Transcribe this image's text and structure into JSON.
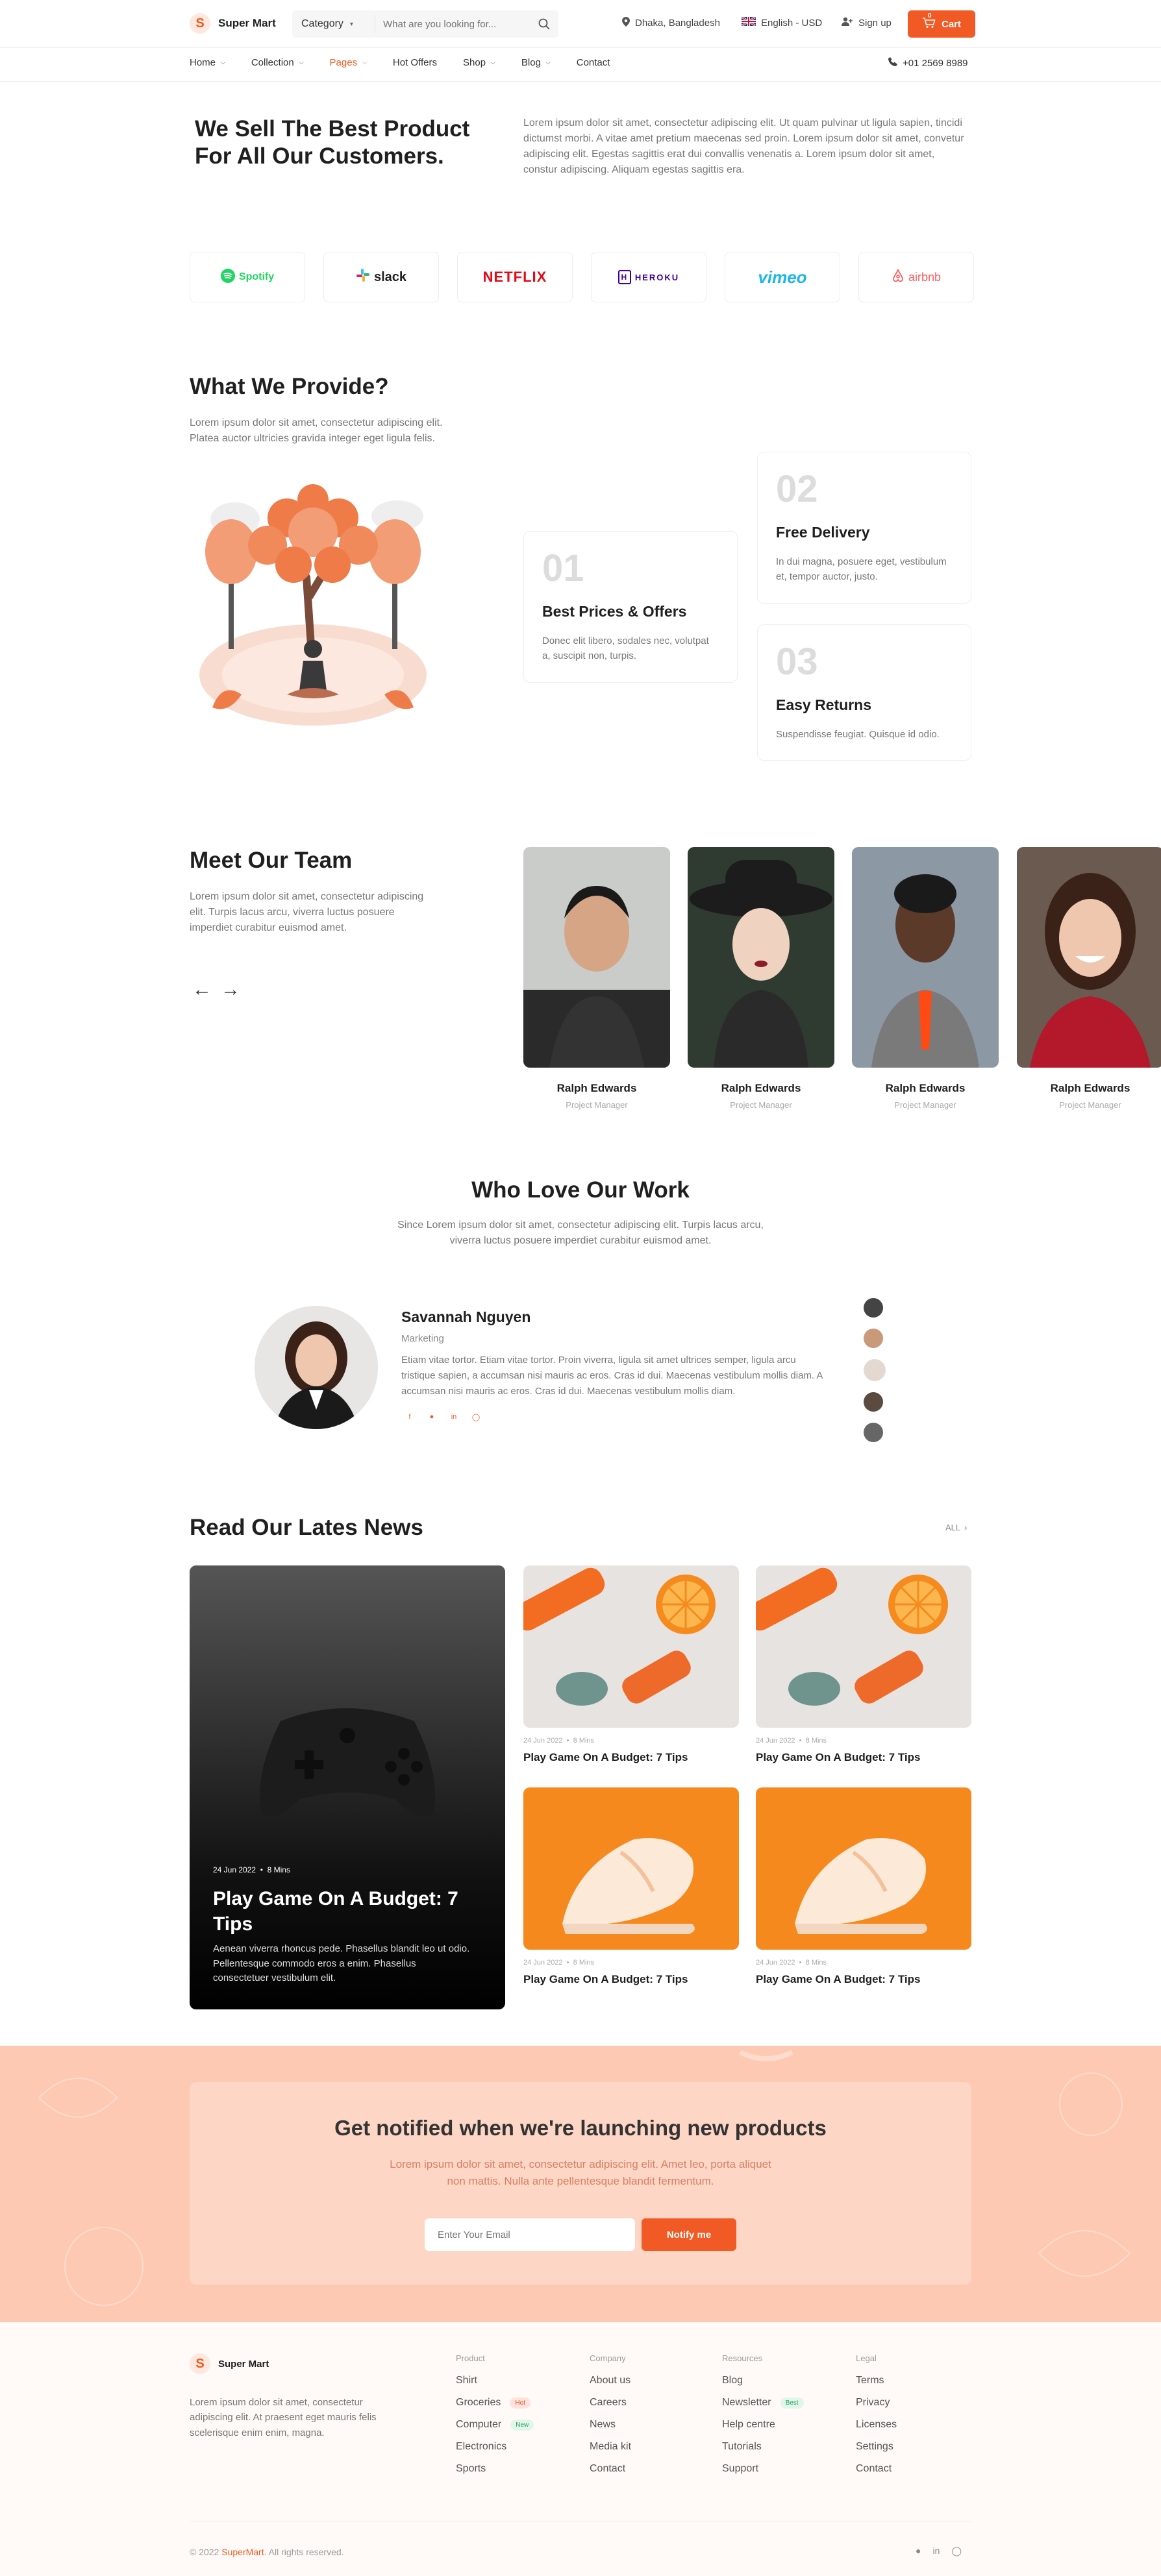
{
  "header": {
    "logo_letter": "S",
    "logo_text": "Super Mart",
    "category": "Category",
    "search_placeholder": "What are you looking for...",
    "location": "Dhaka, Bangladesh",
    "language": "English - USD",
    "signup": "Sign up",
    "cart": "Cart",
    "cart_count": "0",
    "phone": "+01 2569 8989"
  },
  "nav": {
    "items": [
      "Home",
      "Collection",
      "Pages",
      "Hot Offers",
      "Shop",
      "Blog",
      "Contact"
    ]
  },
  "hero": {
    "title": "We Sell The Best Product For All Our Customers.",
    "text": "Lorem ipsum dolor sit amet, consectetur adipiscing elit. Ut quam pulvinar ut ligula sapien, tincidi dictumst morbi. A vitae amet pretium maecenas sed proin. Lorem ipsum dolor sit amet, convetur adipiscing elit. Egestas sagittis erat dui convallis venenatis a. Lorem ipsum dolor sit amet, constur adipiscing. Aliquam egestas sagittis era."
  },
  "brands": [
    "Spotify",
    "slack",
    "NETFLIX",
    "HEROKU",
    "vimeo",
    "airbnb"
  ],
  "provide": {
    "title": "What We Provide?",
    "text": "Lorem ipsum dolor sit amet, consectetur adipiscing elit. Platea auctor ultricies gravida integer eget ligula felis.",
    "cards": [
      {
        "num": "01",
        "title": "Best Prices & Offers",
        "text": "Donec elit libero, sodales nec, volutpat a, suscipit non, turpis."
      },
      {
        "num": "02",
        "title": "Free Delivery",
        "text": "In dui magna, posuere eget, vestibulum et, tempor auctor, justo."
      },
      {
        "num": "03",
        "title": "Easy Returns",
        "text": "Suspendisse feugiat. Quisque id odio."
      }
    ]
  },
  "team": {
    "title": "Meet Our Team",
    "text": "Lorem ipsum dolor sit amet, consectetur adipiscing elit. Turpis lacus arcu, viverra luctus posuere imperdiet curabitur euismod amet.",
    "members": [
      {
        "name": "Ralph Edwards",
        "role": "Project Manager"
      },
      {
        "name": "Ralph Edwards",
        "role": "Project Manager"
      },
      {
        "name": "Ralph Edwards",
        "role": "Project Manager"
      },
      {
        "name": "Ralph Edwards",
        "role": "Project Manager"
      }
    ]
  },
  "testimonials": {
    "title": "Who Love Our Work",
    "text": "Since Lorem ipsum dolor sit amet, consectetur adipiscing elit. Turpis lacus arcu, viverra luctus posuere imperdiet curabitur euismod amet.",
    "name": "Savannah Nguyen",
    "role": "Marketing",
    "quote": "Etiam vitae tortor. Etiam vitae tortor. Proin viverra, ligula sit amet ultrices semper, ligula arcu tristique sapien, a accumsan nisi mauris ac eros. Cras id dui. Maecenas vestibulum mollis diam. A accumsan nisi mauris ac eros. Cras id dui. Maecenas vestibulum mollis diam."
  },
  "news": {
    "title": "Read Our Lates News",
    "all": "ALL",
    "featured": {
      "date": "24 Jun 2022",
      "read": "8 Mins",
      "title": "Play Game On A Budget: 7 Tips",
      "text": "Aenean viverra rhoncus pede. Phasellus blandit leo ut odio. Pellentesque commodo eros a enim. Phasellus consectetuer vestibulum elit."
    },
    "items": [
      {
        "date": "24 Jun 2022",
        "read": "8 Mins",
        "title": "Play Game On A Budget: 7 Tips"
      },
      {
        "date": "24 Jun 2022",
        "read": "8 Mins",
        "title": "Play Game On A Budget: 7 Tips"
      },
      {
        "date": "24 Jun 2022",
        "read": "8 Mins",
        "title": "Play Game On A Budget: 7 Tips"
      },
      {
        "date": "24 Jun 2022",
        "read": "8 Mins",
        "title": "Play Game On A Budget: 7 Tips"
      }
    ]
  },
  "newsletter": {
    "title": "Get notified when we're launching new products",
    "text": "Lorem ipsum dolor sit amet, consectetur adipiscing elit. Amet leo, porta aliquet non mattis. Nulla ante pellentesque blandit fermentum.",
    "placeholder": "Enter Your Email",
    "button": "Notify me"
  },
  "footer": {
    "logo_text": "Super Mart",
    "text": "Lorem ipsum dolor sit amet, consectetur adipiscing elit. At praesent eget mauris felis scelerisque enim enim, magna.",
    "columns": [
      {
        "head": "Product",
        "links": [
          "Shirt",
          "Groceries",
          "Computer",
          "Electronics",
          "Sports"
        ]
      },
      {
        "head": "Company",
        "links": [
          "About us",
          "Careers",
          "News",
          "Media kit",
          "Contact"
        ]
      },
      {
        "head": "Resources",
        "links": [
          "Blog",
          "Newsletter",
          "Help centre",
          "Tutorials",
          "Support"
        ]
      },
      {
        "head": "Legal",
        "links": [
          "Terms",
          "Privacy",
          "Licenses",
          "Settings",
          "Contact"
        ]
      }
    ],
    "badges": {
      "hot": "Hot",
      "new": "New",
      "best": "Best"
    },
    "copy_prefix": "© 2022",
    "copy_brand": "SuperMart",
    "copy_suffix": ". All rights reserved."
  },
  "colors": {
    "accent": "#f15a24",
    "peach": "#fdc9b2"
  }
}
